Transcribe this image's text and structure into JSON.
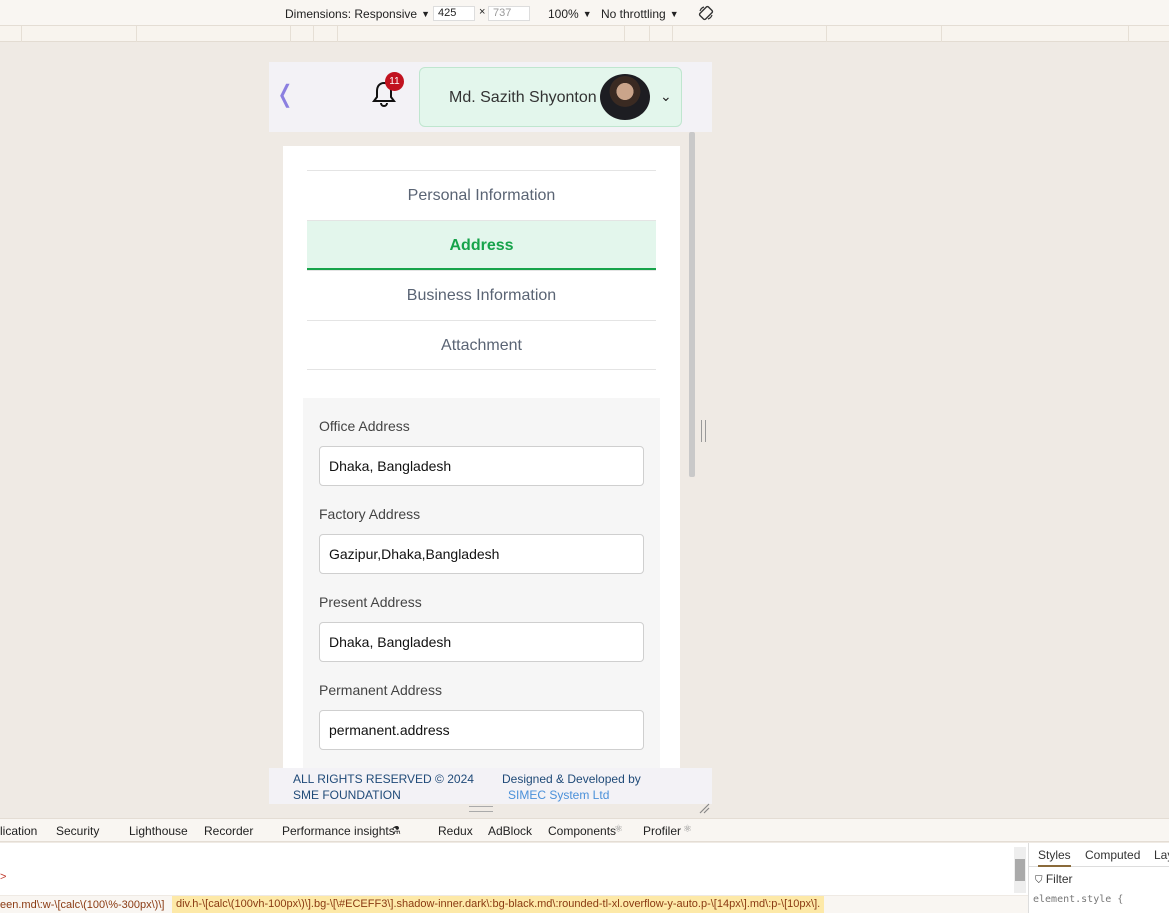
{
  "devtools": {
    "dimensions_label": "Dimensions: Responsive",
    "width": "425",
    "height": "737",
    "zoom": "100%",
    "throttling": "No throttling",
    "tabs": [
      "lication",
      "Security",
      "Lighthouse",
      "Recorder",
      "Performance insights",
      "Redux",
      "AdBlock",
      "Components",
      "Profiler"
    ],
    "styles_tabs": [
      "Styles",
      "Computed",
      "Lay"
    ],
    "filter_label": "Filter",
    "element_style": "element.style {",
    "breadcrumb_left": "een.md\\:w-\\[calc\\(100\\%-300px\\)\\]",
    "breadcrumb_selected": "div.h-\\[calc\\(100vh-100px\\)\\].bg-\\[\\#ECEFF3\\].shadow-inner.dark\\:bg-black.md\\:rounded-tl-xl.overflow-y-auto.p-\\[14px\\].md\\:p-\\[10px\\]."
  },
  "header": {
    "notification_count": "11",
    "user_name": "Md. Sazith Shyonton"
  },
  "tabs": {
    "personal": "Personal Information",
    "address": "Address",
    "business": "Business Information",
    "attachment": "Attachment"
  },
  "form": {
    "office_label": "Office Address",
    "office_value": "Dhaka, Bangladesh",
    "factory_label": "Factory Address",
    "factory_value": "Gazipur,Dhaka,Bangladesh",
    "present_label": "Present Address",
    "present_value": "Dhaka, Bangladesh",
    "permanent_label": "Permanent Address",
    "permanent_value": "permanent.address"
  },
  "footer": {
    "rights": "ALL RIGHTS RESERVED © 2024 SME FOUNDATION",
    "designed": "Designed & Developed by",
    "company": "SIMEC System Ltd"
  },
  "colors": {
    "accent": "#16a34a",
    "accent_bg": "#e3f6ec",
    "badge": "#c1121f"
  }
}
